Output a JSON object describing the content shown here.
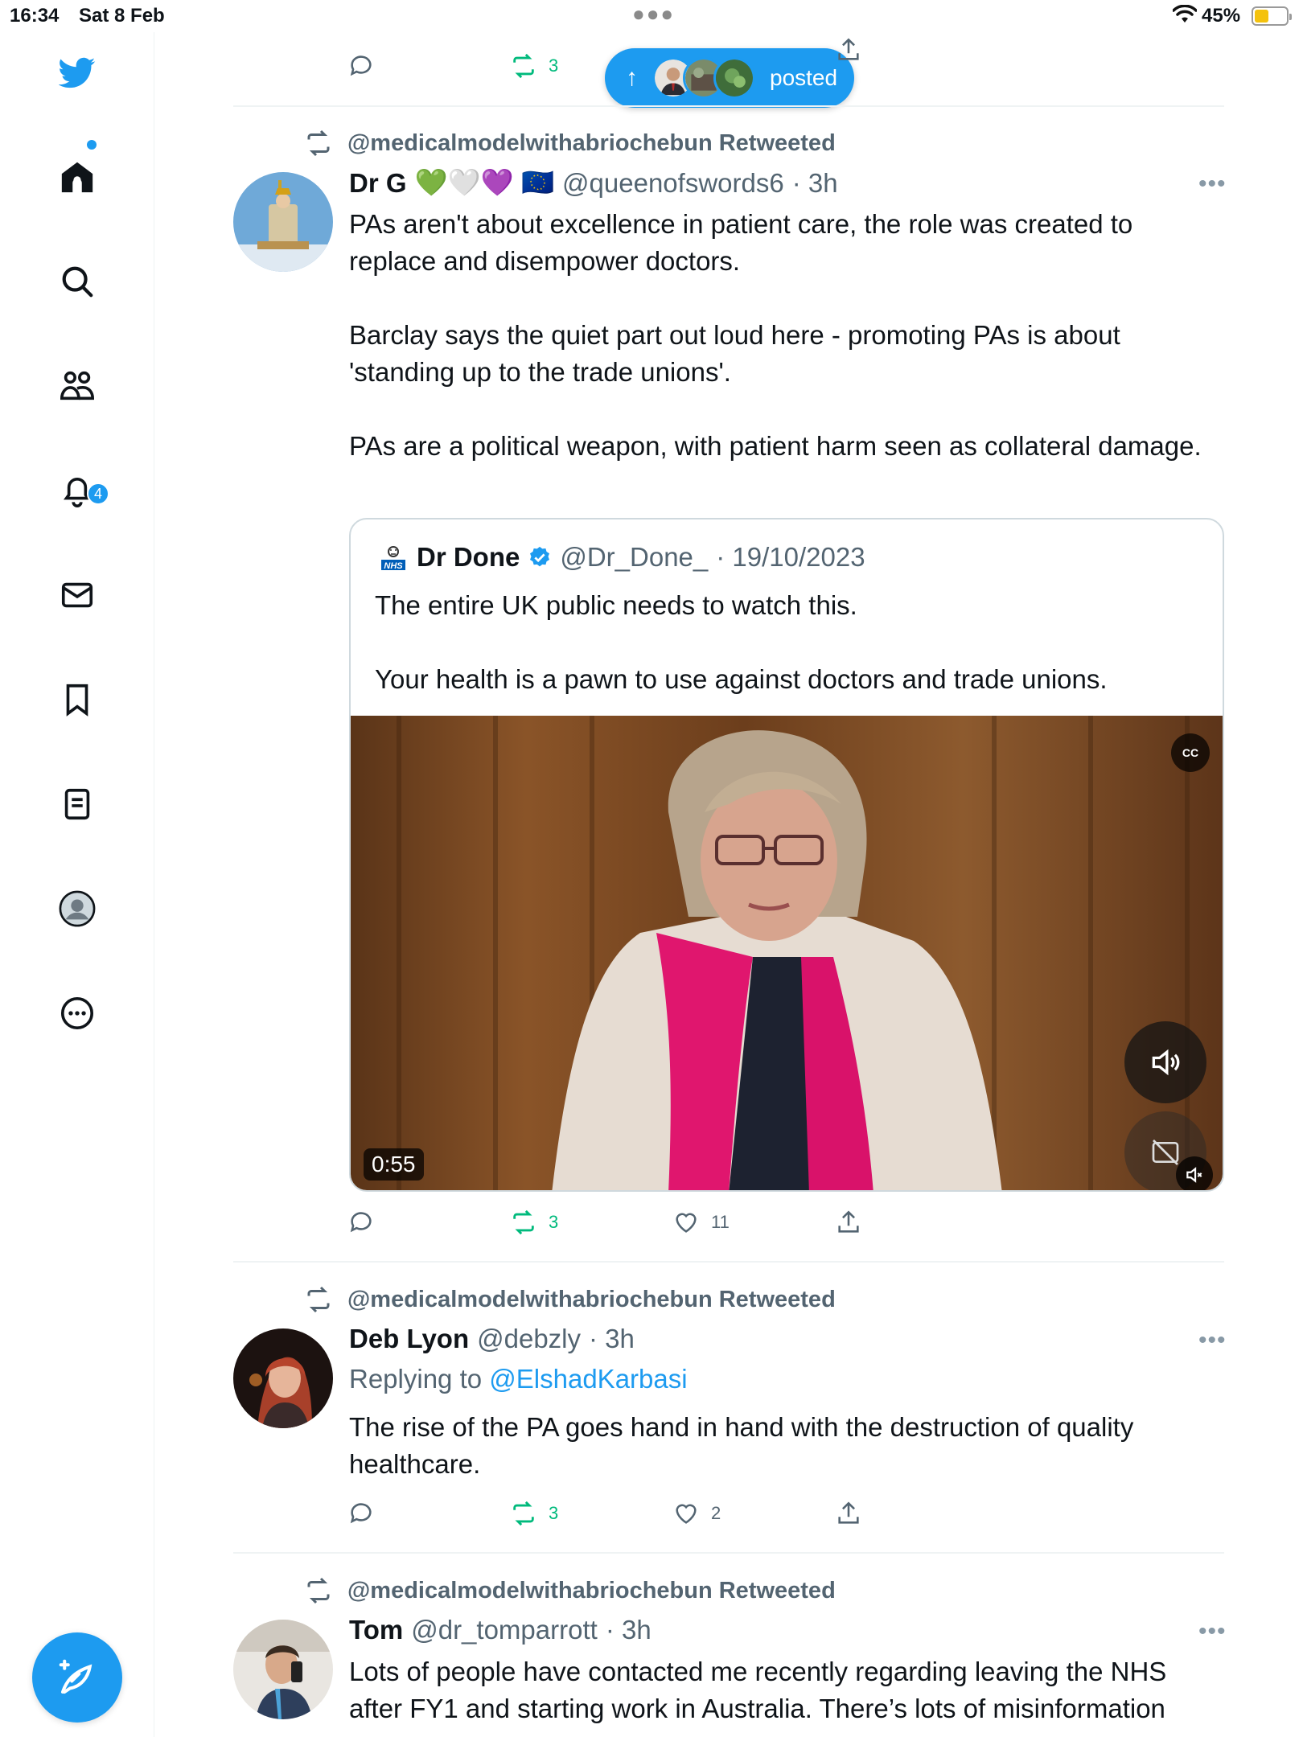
{
  "status_bar": {
    "time": "16:34",
    "date": "Sat 8 Feb",
    "battery": "45%",
    "battery_level": 0.45
  },
  "sidebar": {
    "icons": [
      "twitter-bird-icon",
      "home-icon",
      "search-icon",
      "communities-icon",
      "notifications-icon",
      "messages-icon",
      "bookmarks-icon",
      "lists-icon",
      "profile-icon",
      "more-icon"
    ],
    "notification_count": "4",
    "compose_icon": "compose-feather-icon"
  },
  "new_posts_pill": {
    "label": "posted",
    "arrow": "↑"
  },
  "top_partial_tweet": {
    "retweets": "3"
  },
  "tweets": [
    {
      "retweeted_by": "@medicalmodelwithabriochebun Retweeted",
      "name": "Dr G",
      "emoji": "💚🤍💜 🇪🇺",
      "handle": "@queenofswords6",
      "time": "· 3h",
      "paragraphs": [
        "PAs aren't about excellence in patient care, the role was created to replace and disempower doctors.",
        "Barclay says the quiet part out loud here - promoting PAs is about 'standing up to the trade unions'.",
        "PAs are a political weapon, with patient harm seen as collateral damage."
      ],
      "quote": {
        "name": "Dr Done",
        "handle": "@Dr_Done_",
        "time": "· 19/10/2023",
        "paragraphs": [
          "The entire UK public needs to watch this.",
          "Your health is a pawn to use against doctors and trade unions."
        ],
        "video_duration": "0:55",
        "cc_label": "CC"
      },
      "retweets": "3",
      "likes": "11"
    },
    {
      "retweeted_by": "@medicalmodelwithabriochebun Retweeted",
      "name": "Deb Lyon",
      "handle": "@debzly",
      "time": "· 3h",
      "replying_prefix": "Replying to",
      "replying_to": "@ElshadKarbasi",
      "paragraphs": [
        "The rise of the PA goes hand in hand with the destruction of quality healthcare."
      ],
      "retweets": "3",
      "likes": "2"
    },
    {
      "retweeted_by": "@medicalmodelwithabriochebun Retweeted",
      "name": "Tom",
      "handle": "@dr_tomparrott",
      "time": "· 3h",
      "paragraphs": [
        "Lots of people have contacted me recently regarding leaving the NHS after FY1 and starting work in Australia. There’s lots of misinformation"
      ]
    }
  ],
  "colors": {
    "accent": "#1d9bf0",
    "retweet_green": "#00ba7c",
    "muted_text": "#536471",
    "divider": "#eff3f4"
  }
}
